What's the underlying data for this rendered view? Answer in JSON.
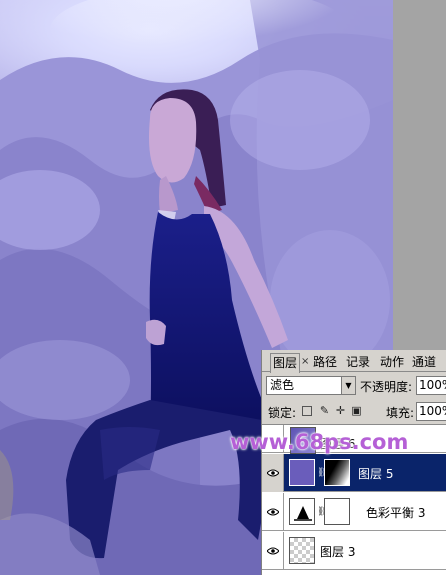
{
  "photo": {
    "description_colors": {
      "sky": "#dfe1ff",
      "foliage": "#8b86d2",
      "dress": "#141a7a"
    }
  },
  "layers_panel": {
    "tabs": [
      {
        "label": "图层",
        "active": true
      },
      {
        "label": "路径",
        "active": false
      },
      {
        "label": "记录",
        "active": false
      },
      {
        "label": "动作",
        "active": false
      },
      {
        "label": "通道",
        "active": false
      }
    ],
    "tab_close": "×",
    "blend_mode": "滤色",
    "opacity_label": "不透明度:",
    "opacity_value": "100%",
    "lock_label": "锁定:",
    "fill_label": "填充:",
    "fill_value": "100%",
    "layers": [
      {
        "name": "图层 6",
        "visible": false,
        "selected": false
      },
      {
        "name": "图层 5",
        "visible": true,
        "selected": true
      },
      {
        "name": "色彩平衡 3",
        "visible": true,
        "selected": false
      },
      {
        "name": "图层 3",
        "visible": true,
        "selected": false
      }
    ]
  },
  "watermark": "www.68ps.com",
  "colors": {
    "panel_bg": "#d6d3ce",
    "selection": "#0a246a",
    "watermark": "#b560d6"
  }
}
